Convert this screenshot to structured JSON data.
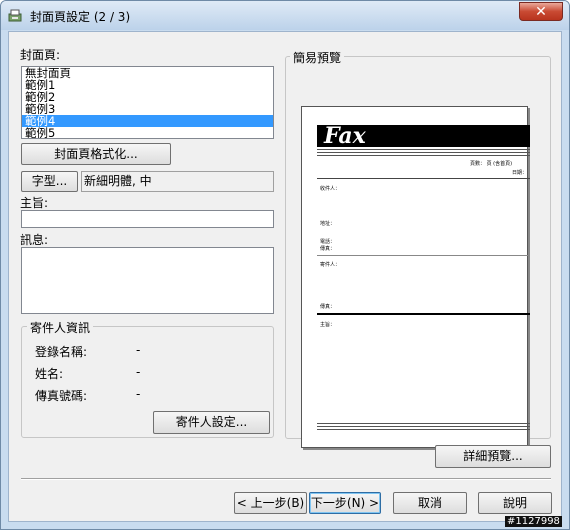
{
  "window": {
    "title": "封面頁設定 (2 / 3)",
    "close_label": "✕"
  },
  "cover": {
    "label": "封面頁:",
    "items": [
      "無封面頁",
      "範例1",
      "範例2",
      "範例3",
      "範例4",
      "範例5"
    ],
    "selected_index": 4,
    "format_button": "封面頁格式化..."
  },
  "font": {
    "button": "字型...",
    "value": "新細明體, 中"
  },
  "subject": {
    "label": "主旨:",
    "value": ""
  },
  "message": {
    "label": "訊息:",
    "value": ""
  },
  "sender": {
    "group_label": "寄件人資訊",
    "fields": [
      {
        "label": "登錄名稱:",
        "value": "-"
      },
      {
        "label": "姓名:",
        "value": "-"
      },
      {
        "label": "傳真號碼:",
        "value": "-"
      }
    ],
    "settings_button": "寄件人設定..."
  },
  "preview": {
    "group_label": "簡易預覽",
    "fax_title": "Fax",
    "pages_text": "頁數： 頁 (含首頁)",
    "date_text": "日期：",
    "to_text": "收件人：",
    "address_text": "地址：",
    "phone_text": "電話：",
    "fax_text": "傳真：",
    "from_text": "寄件人：",
    "fax2_text": "傳真：",
    "subject_text": "主旨："
  },
  "detail_preview_button": "詳細預覽...",
  "buttons": {
    "back": "< 上一步(B)",
    "next": "下一步(N) >",
    "cancel": "取消",
    "help": "說明"
  },
  "watermark": "#1127998"
}
